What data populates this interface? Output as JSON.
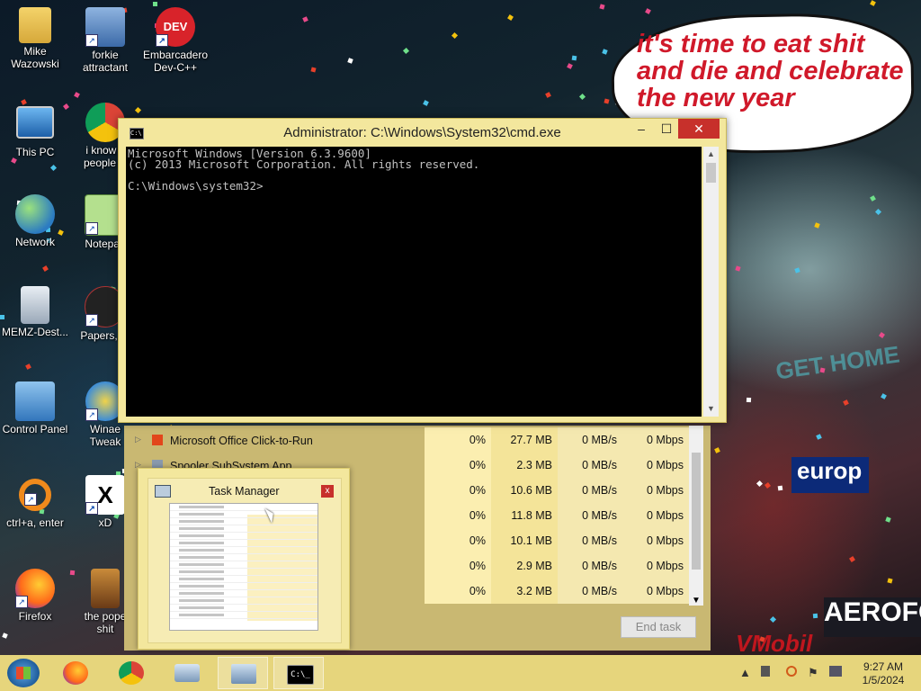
{
  "desktop": {
    "speech_bubble": {
      "line1": "it's time to eat shit",
      "line2": "and die and celebrate",
      "line3": "the new year"
    },
    "wallpaper_signs": {
      "gethome": "GET HOME",
      "europ": "europ",
      "aero": "AEROFO",
      "vmobil": "VMobil"
    },
    "icons": [
      {
        "label": "Mike\nWazowski",
        "l1": "Mike",
        "l2": "Wazowski",
        "icon": "folder-icon"
      },
      {
        "label": "forkie attractant",
        "l1": "forkie",
        "l2": "attractant",
        "icon": "control-panel-icon"
      },
      {
        "label": "Embarcadero Dev-C++",
        "l1": "Embarcadero",
        "l2": "Dev-C++",
        "icon": "dev-cpp-icon"
      },
      {
        "label": "This PC",
        "l1": "This PC",
        "l2": "",
        "icon": "computer-icon"
      },
      {
        "label": "i know y people w",
        "l1": "i know y",
        "l2": "people w",
        "icon": "chrome-icon"
      },
      {
        "label": "Network",
        "l1": "Network",
        "l2": "",
        "icon": "network-icon"
      },
      {
        "label": "Notepad",
        "l1": "Notepad",
        "l2": "",
        "icon": "notepad-icon"
      },
      {
        "label": "MEMZ-Dest...",
        "l1": "MEMZ-Dest...",
        "l2": "",
        "icon": "recycle-bin-icon"
      },
      {
        "label": "Papers, Pl",
        "l1": "Papers, Pl",
        "l2": "",
        "icon": "papers-please-icon"
      },
      {
        "label": "Control Panel",
        "l1": "Control Panel",
        "l2": "",
        "icon": "control-panel-icon"
      },
      {
        "label": "Winaero Tweak",
        "l1": "Winae",
        "l2": "Tweak",
        "icon": "winaero-icon"
      },
      {
        "label": "ctrl+a, enter",
        "l1": "ctrl+a, enter",
        "l2": "",
        "icon": "orange-ring-icon"
      },
      {
        "label": "xD",
        "l1": "xD",
        "l2": "",
        "icon": "x-icon"
      },
      {
        "label": "Firefox",
        "l1": "Firefox",
        "l2": "",
        "icon": "firefox-icon"
      },
      {
        "label": "the pope shit",
        "l1": "the pope",
        "l2": "shit",
        "icon": "image-icon"
      }
    ]
  },
  "cmd_window": {
    "title": "Administrator: C:\\Windows\\System32\\cmd.exe",
    "minimize": "–",
    "maximize": "☐",
    "close": "✕",
    "lines": [
      "Microsoft Windows [Version 6.3.9600]",
      "(c) 2013 Microsoft Corporation. All rights reserved.",
      "",
      "C:\\Windows\\system32>"
    ]
  },
  "task_manager": {
    "rows": [
      {
        "name": "Microsoft Office Click-to-Run",
        "cpu": "0%",
        "memory": "27.7 MB",
        "disk": "0 MB/s",
        "network": "0 Mbps",
        "icon": "office-icon"
      },
      {
        "name": "Spooler SubSystem App",
        "cpu": "0%",
        "memory": "2.3 MB",
        "disk": "0 MB/s",
        "network": "0 Mbps",
        "icon": "printer-icon"
      },
      {
        "name": "",
        "cpu": "0%",
        "memory": "10.6 MB",
        "disk": "0 MB/s",
        "network": "0 Mbps",
        "icon": ""
      },
      {
        "name": "",
        "cpu": "0%",
        "memory": "11.8 MB",
        "disk": "0 MB/s",
        "network": "0 Mbps",
        "icon": ""
      },
      {
        "name": "",
        "cpu": "0%",
        "memory": "10.1 MB",
        "disk": "0 MB/s",
        "network": "0 Mbps",
        "icon": ""
      },
      {
        "name": "",
        "cpu": "0%",
        "memory": "2.9 MB",
        "disk": "0 MB/s",
        "network": "0 Mbps",
        "icon": ""
      },
      {
        "name": "",
        "cpu": "0%",
        "memory": "3.2 MB",
        "disk": "0 MB/s",
        "network": "0 Mbps",
        "icon": ""
      }
    ],
    "end_task": "End task"
  },
  "thumbnail_preview": {
    "title": "Task Manager",
    "close": "x"
  },
  "taskbar": {
    "buttons": [
      "start-button",
      "firefox",
      "chrome",
      "on-screen-keyboard",
      "task-manager",
      "cmd"
    ],
    "cmd_glyph": "C:\\_",
    "tray": {
      "up_arrow": "▲",
      "flag": "⚑"
    },
    "clock": {
      "time": "9:27 AM",
      "date": "1/5/2024"
    }
  },
  "colors": {
    "theme": "#f3e79d",
    "taskbar": "#e6d57c",
    "close_red": "#c7302b"
  }
}
